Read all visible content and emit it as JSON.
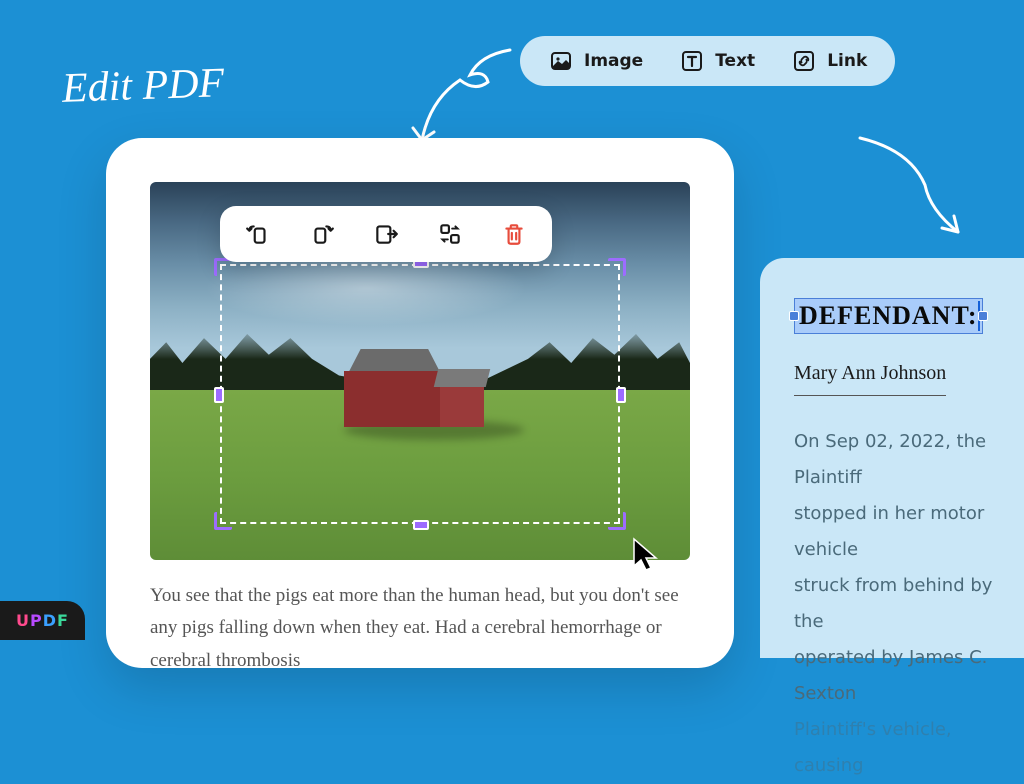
{
  "hero_title": "Edit PDF",
  "toolbar": {
    "image_label": "Image",
    "text_label": "Text",
    "link_label": "Link"
  },
  "document": {
    "body_text": "You see that the pigs eat more than the human head, but you don't see any pigs falling down when they eat. Had a cerebral hemorrhage or cerebral thrombosis"
  },
  "side_document": {
    "heading": "DEFENDANT:",
    "name": "Mary Ann Johnson",
    "body_line1": "On Sep 02, 2022, the Plaintiff",
    "body_line2": "stopped in her motor vehicle",
    "body_line3": "struck from behind by the",
    "body_line4": "operated by James C. Sexton",
    "body_line5": "Plaintiff's vehicle, causing"
  },
  "image_tools": {
    "rotate_left": "rotate-left",
    "rotate_right": "rotate-right",
    "extract": "extract",
    "replace": "replace",
    "delete": "delete"
  },
  "logo": {
    "u": "U",
    "p": "P",
    "d": "D",
    "f": "F"
  }
}
